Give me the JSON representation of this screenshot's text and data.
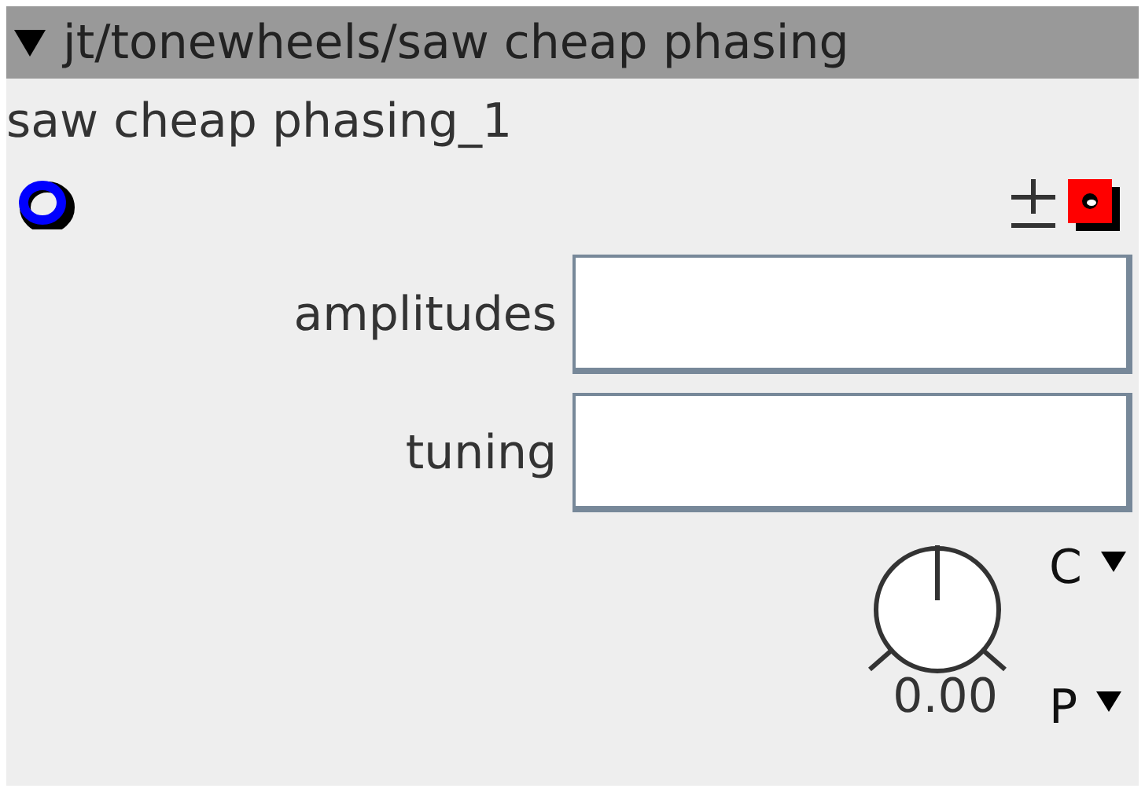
{
  "panel": {
    "title": "jt/tonewheels/saw cheap phasing",
    "expanded": true,
    "instance_name": "saw cheap phasing_1"
  },
  "fields": [
    {
      "label": "amplitudes"
    },
    {
      "label": "tuning"
    }
  ],
  "knob": {
    "reading": "0.00"
  },
  "dropdowns": [
    {
      "label": "C"
    },
    {
      "label": "P"
    }
  ]
}
